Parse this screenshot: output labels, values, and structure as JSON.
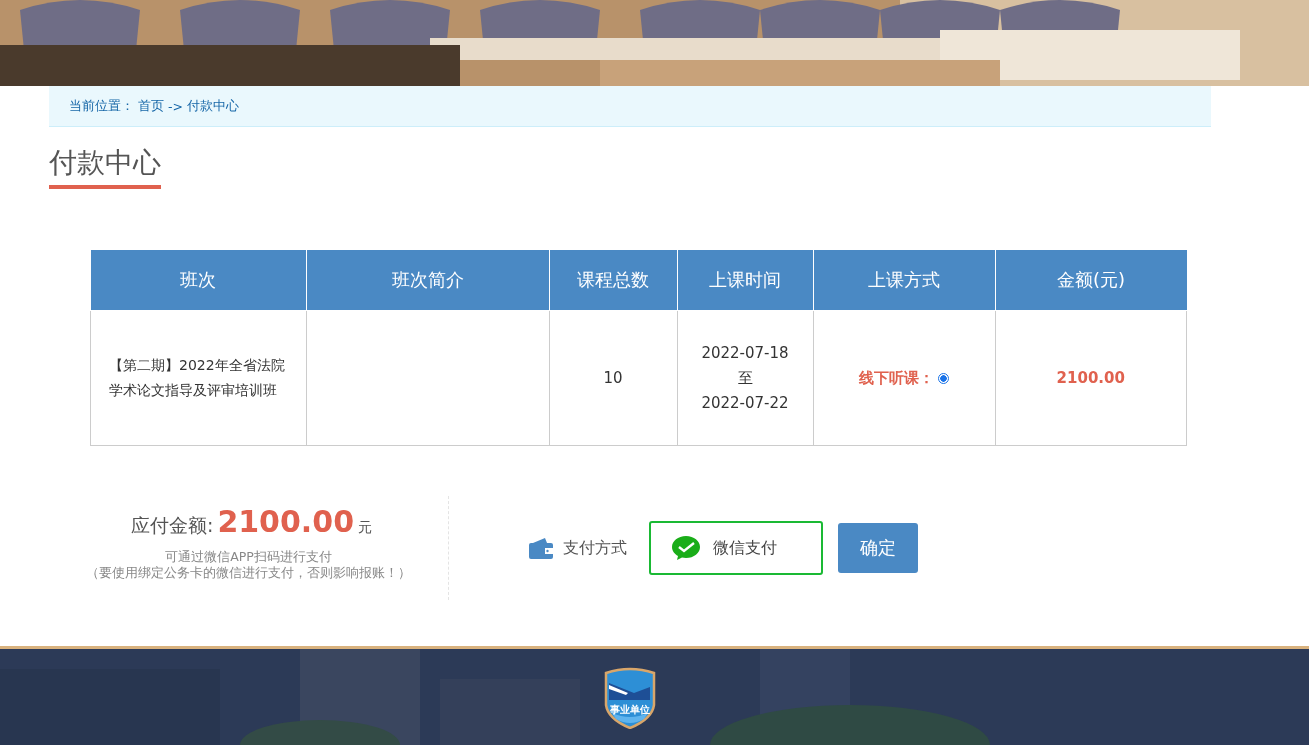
{
  "breadcrumb": {
    "label": "当前位置：",
    "items": [
      "首页",
      "付款中心"
    ],
    "separator": "->"
  },
  "page_title": "付款中心",
  "table": {
    "columns": [
      "班次",
      "班次简介",
      "课程总数",
      "上课时间",
      "上课方式",
      "金额(元)"
    ],
    "rows": [
      {
        "class_name": "【第二期】2022年全省法院学术论文指导及评审培训班",
        "intro": "",
        "course_count": "10",
        "start_date": "2022-07-18",
        "date_sep": "至",
        "end_date": "2022-07-22",
        "mode_label": "线下听课：",
        "mode_selected": true,
        "amount": "2100.00"
      }
    ]
  },
  "summary": {
    "label": "应付金额:",
    "amount": "2100.00",
    "unit": "元",
    "note_lines": [
      "可通过微信APP扫码进行支付",
      "（要使用绑定公务卡的微信进行支付，否则影响报账！）"
    ]
  },
  "payment": {
    "label": "支付方式",
    "options": [
      {
        "label": "微信支付",
        "selected": true
      }
    ],
    "confirm": "确定"
  },
  "footer": {
    "badge_text": "事业单位"
  }
}
